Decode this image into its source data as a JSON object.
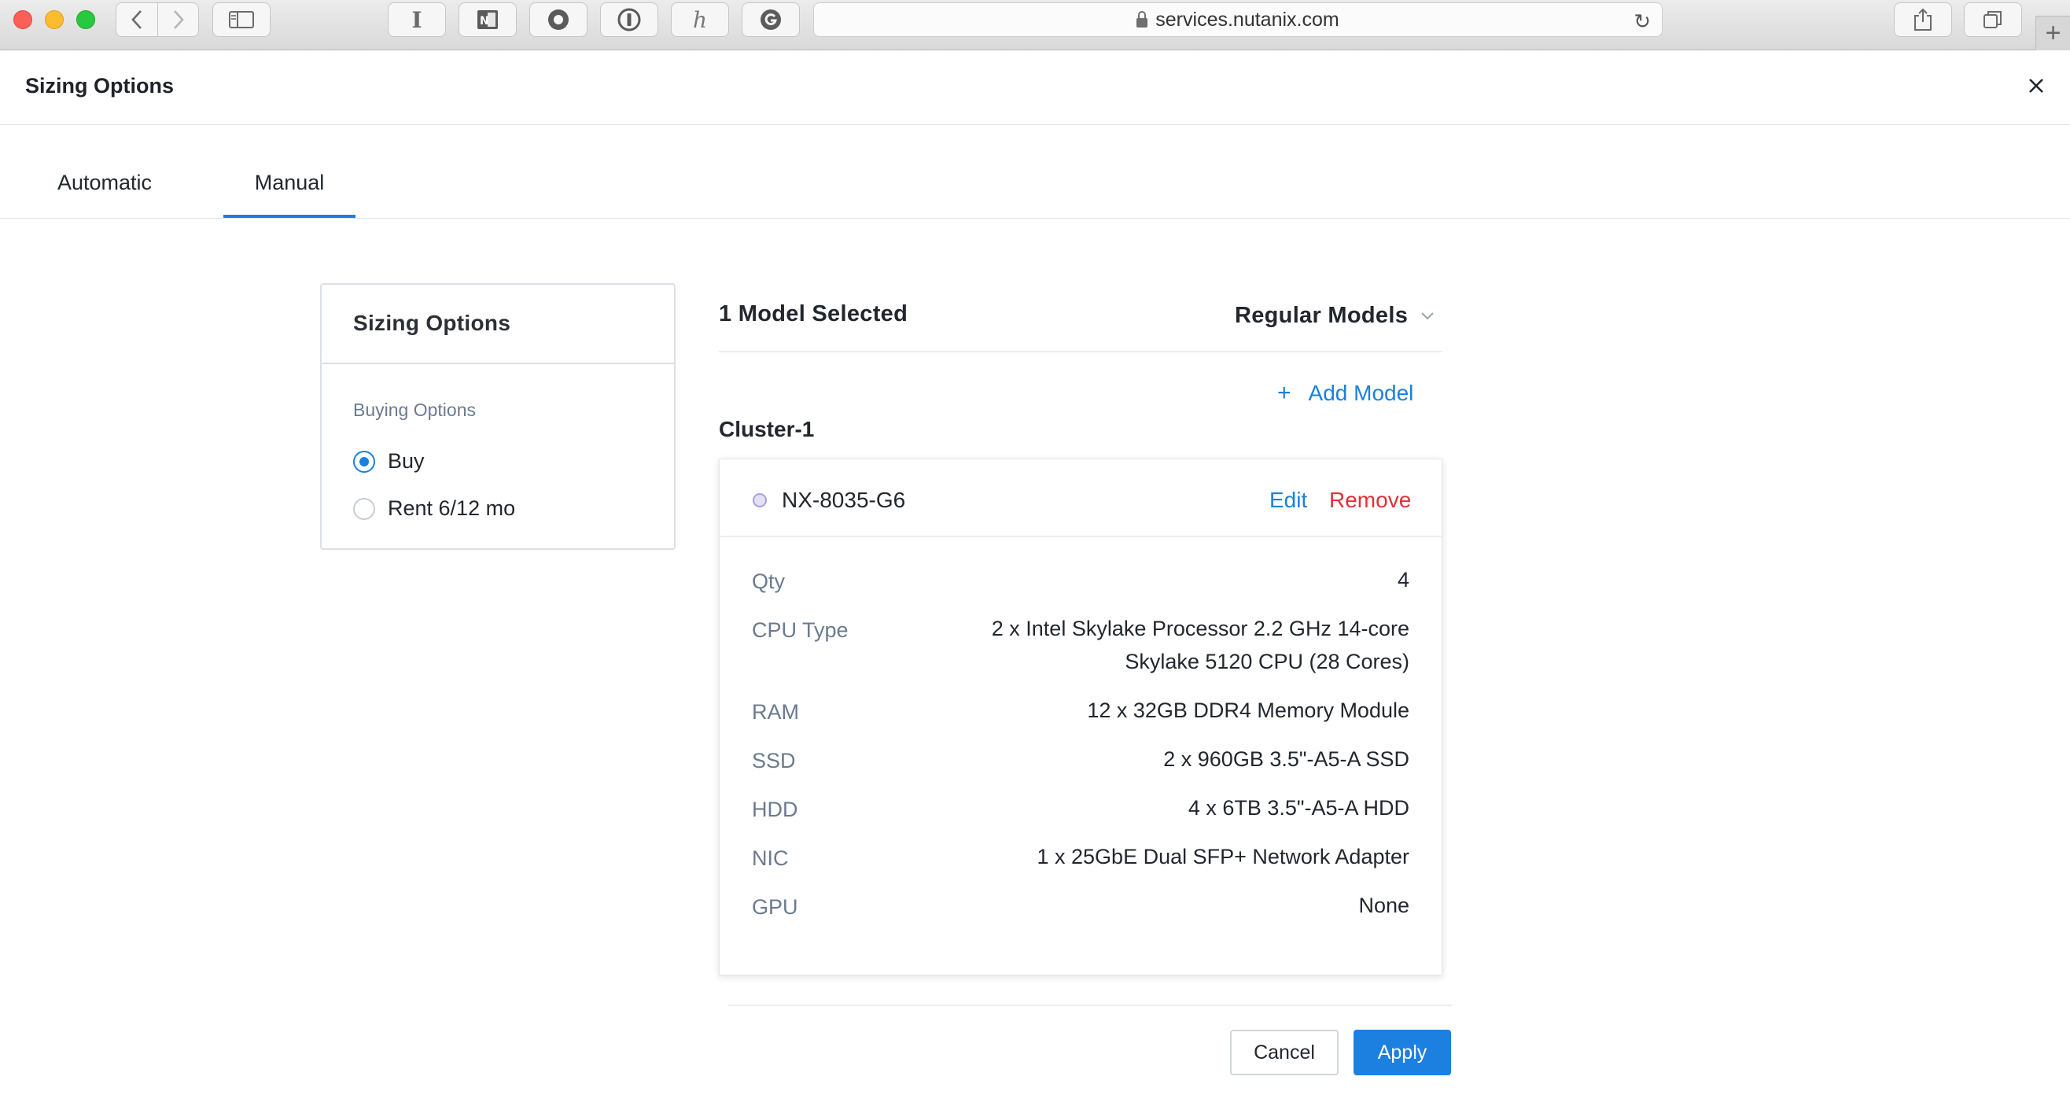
{
  "browser": {
    "url": "services.nutanix.com"
  },
  "modal": {
    "title": "Sizing Options"
  },
  "tabs": [
    {
      "label": "Automatic",
      "active": false
    },
    {
      "label": "Manual",
      "active": true
    }
  ],
  "sidebar": {
    "title": "Sizing Options",
    "subtitle": "Buying Options",
    "options": [
      {
        "label": "Buy",
        "selected": true
      },
      {
        "label": "Rent 6/12 mo",
        "selected": false
      }
    ]
  },
  "models": {
    "count_label": "1 Model Selected",
    "type_selected": "Regular Models",
    "add_label": "Add Model"
  },
  "cluster": {
    "name": "Cluster-1",
    "model": {
      "name": "NX-8035-G6",
      "edit_label": "Edit",
      "remove_label": "Remove",
      "specs": [
        {
          "label": "Qty",
          "value": "4"
        },
        {
          "label": "CPU Type",
          "value_lines": [
            "2 x Intel Skylake Processor 2.2 GHz 14-core",
            "Skylake 5120 CPU (28 Cores)"
          ]
        },
        {
          "label": "RAM",
          "value": "12 x 32GB DDR4 Memory Module"
        },
        {
          "label": "SSD",
          "value": "2 x 960GB 3.5\"-A5-A SSD"
        },
        {
          "label": "HDD",
          "value": "4 x 6TB 3.5\"-A5-A HDD"
        },
        {
          "label": "NIC",
          "value": "1 x 25GbE Dual SFP+ Network Adapter"
        },
        {
          "label": "GPU",
          "value": "None"
        }
      ]
    }
  },
  "footer": {
    "cancel_label": "Cancel",
    "apply_label": "Apply"
  },
  "colors": {
    "accent": "#1b80e0",
    "danger": "#e0313a",
    "muted_text": "#6b7a90"
  }
}
